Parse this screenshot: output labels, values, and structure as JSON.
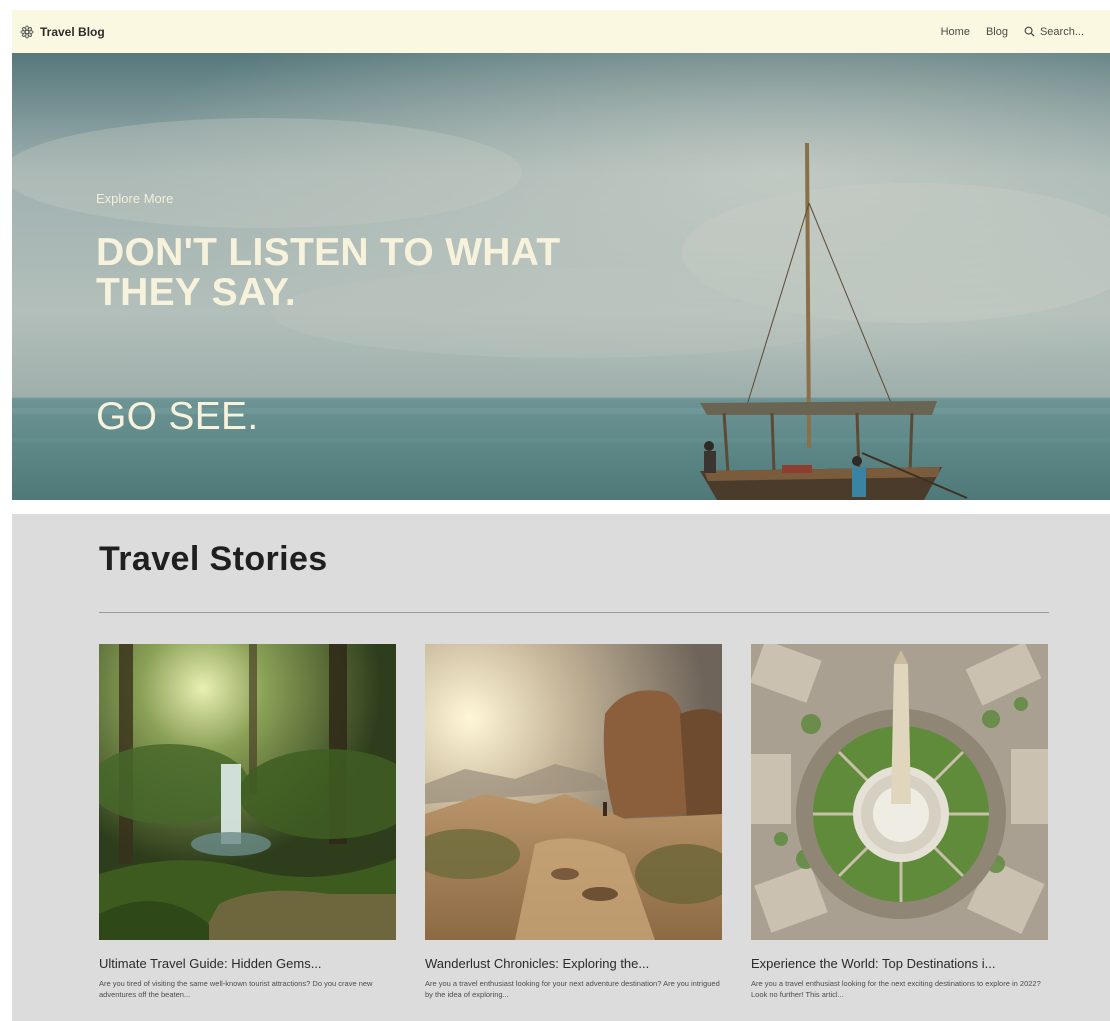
{
  "header": {
    "brand": "Travel Blog",
    "brand_icon": "gear-flower-icon",
    "nav": [
      {
        "label": "Home"
      },
      {
        "label": "Blog"
      }
    ],
    "search": {
      "placeholder": "Search...",
      "icon": "search-icon"
    }
  },
  "hero": {
    "eyebrow": "Explore More",
    "headline_line1": "DON'T LISTEN TO WHAT",
    "headline_line2": "THEY SAY.",
    "cta": "GO SEE.",
    "text_color": "#f7f2dc"
  },
  "stories": {
    "title": "Travel Stories",
    "posts": [
      {
        "title": "Ultimate Travel Guide: Hidden Gems...",
        "excerpt": "Are you tired of visiting the same well-known tourist attractions? Do you crave new adventures off the beaten...",
        "image": "forest-waterfall"
      },
      {
        "title": "Wanderlust Chronicles: Exploring the...",
        "excerpt": "Are you a travel enthusiast looking for your next adventure destination? Are you intrigued by the idea of exploring...",
        "image": "desert-rocks"
      },
      {
        "title": "Experience the World: Top Destinations i...",
        "excerpt": "Are you a travel enthusiast looking for the next exciting destinations to explore in 2022? Look no further! This articl...",
        "image": "city-monument-aerial"
      }
    ]
  },
  "colors": {
    "header_bg": "#fbf8e2",
    "stories_bg": "#dcdcdc"
  }
}
